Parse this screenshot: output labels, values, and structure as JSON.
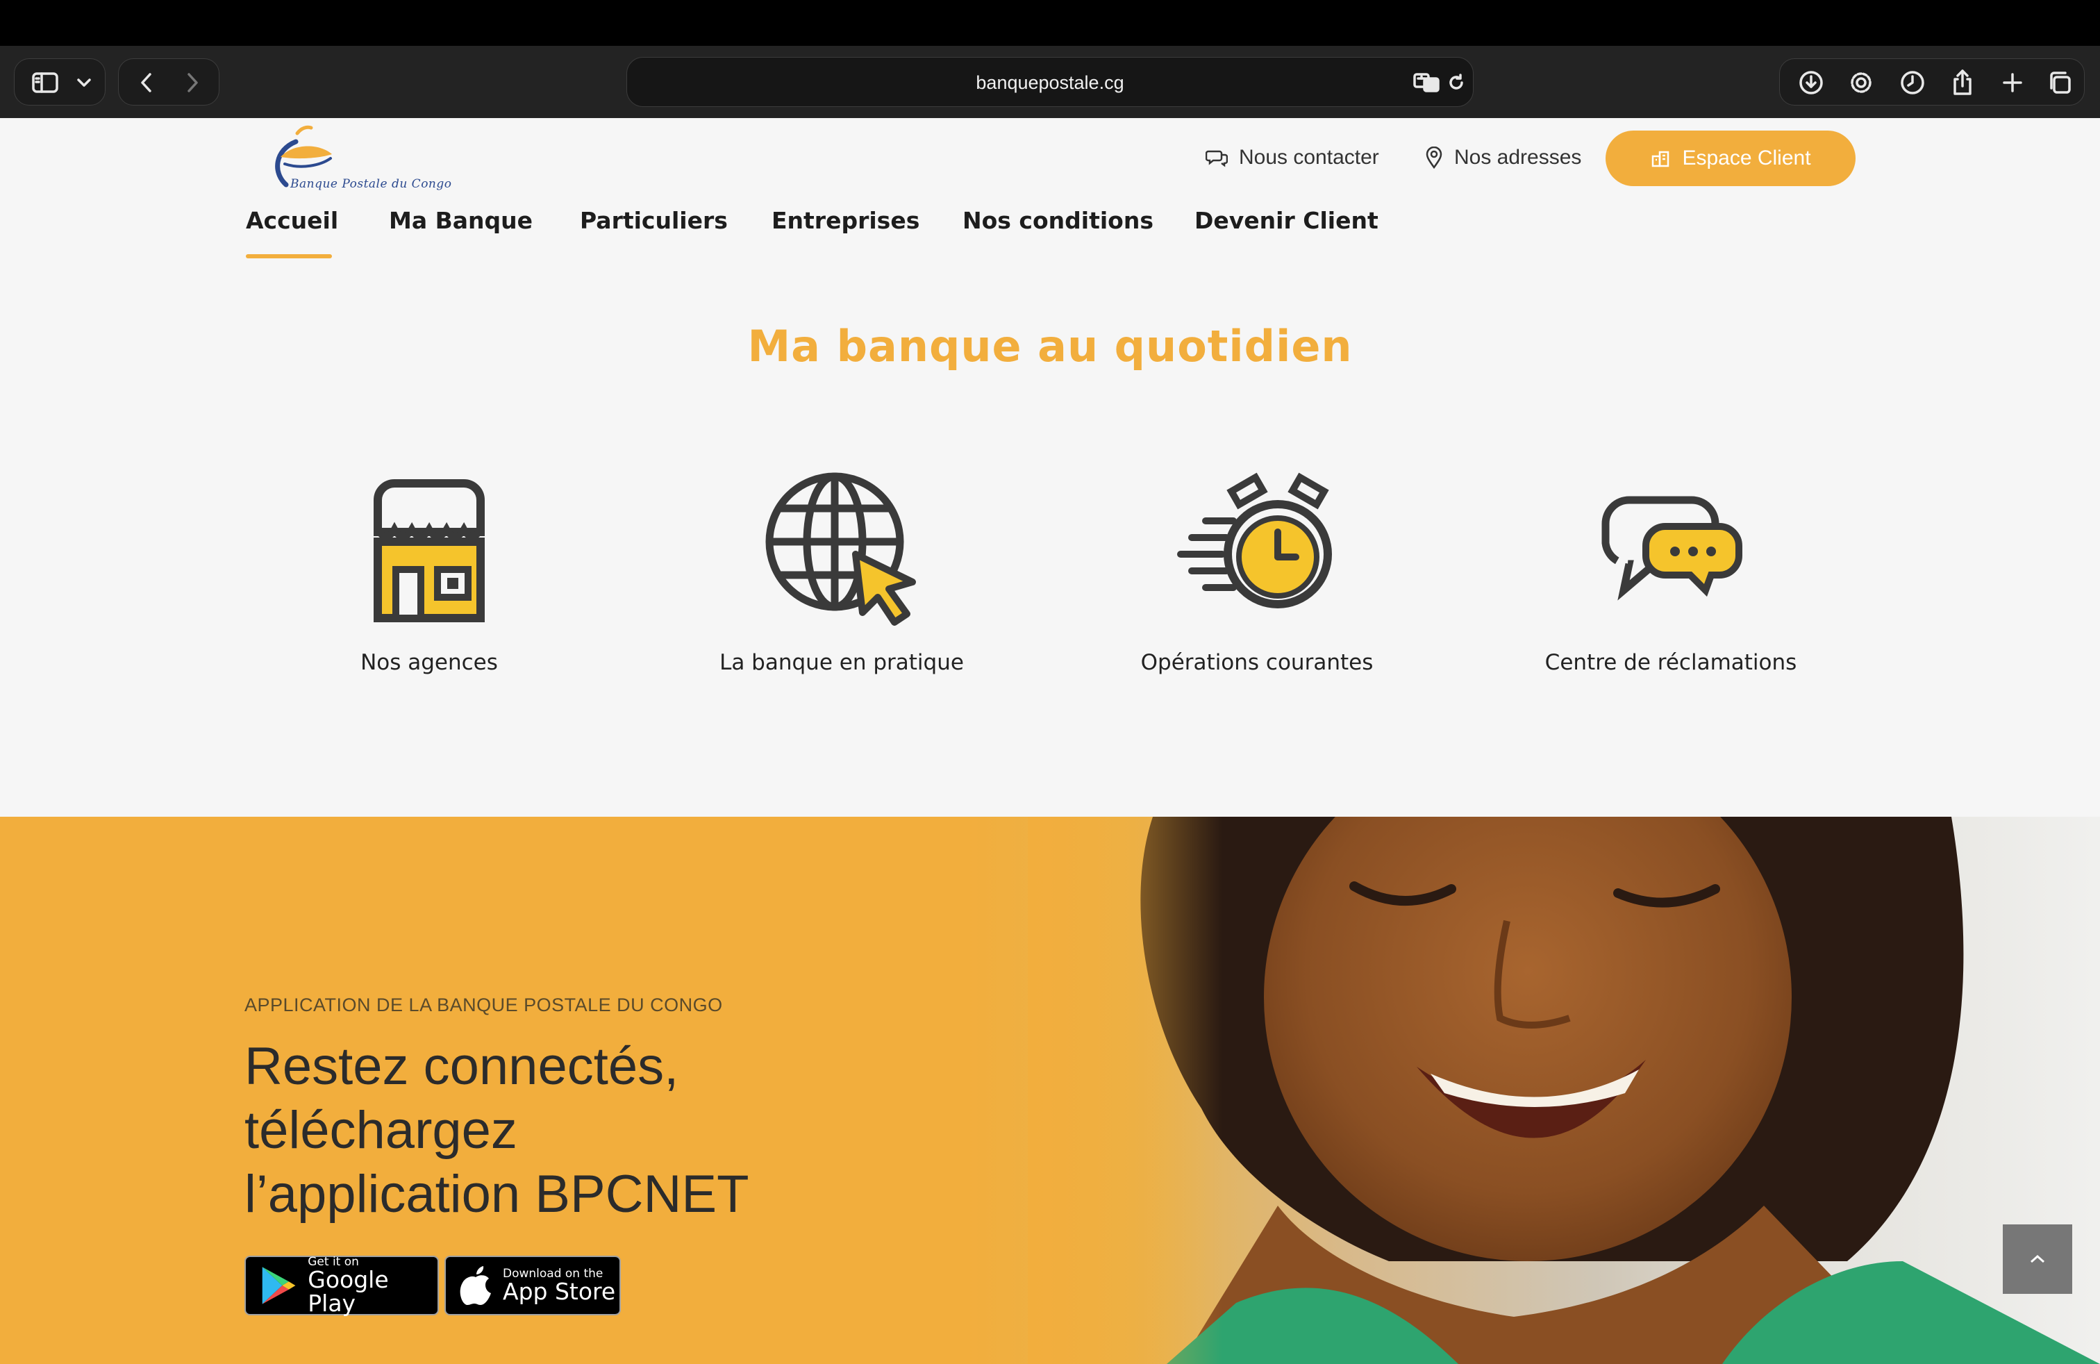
{
  "browser": {
    "url": "banquepostale.cg"
  },
  "header": {
    "logo_text": "Banque Postale du Congo",
    "contact_label": "Nous contacter",
    "addresses_label": "Nos adresses",
    "client_button": "Espace Client"
  },
  "nav": {
    "items": [
      {
        "label": "Accueil"
      },
      {
        "label": "Ma Banque"
      },
      {
        "label": "Particuliers"
      },
      {
        "label": "Entreprises"
      },
      {
        "label": "Nos conditions"
      },
      {
        "label": "Devenir Client"
      }
    ],
    "active": "Accueil"
  },
  "quotidien": {
    "title": "Ma banque au quotidien",
    "features": [
      {
        "label": "Nos agences",
        "icon": "storefront-icon"
      },
      {
        "label": "La banque en pratique",
        "icon": "globe-cursor-icon"
      },
      {
        "label": "Opérations courantes",
        "icon": "stopwatch-icon"
      },
      {
        "label": "Centre de réclamations",
        "icon": "chat-bubbles-icon"
      }
    ]
  },
  "app_banner": {
    "eyebrow": "APPLICATION DE LA BANQUE POSTALE DU CONGO",
    "headline_lines": [
      "Restez connectés,",
      "téléchargez",
      "l’application BPCNET"
    ],
    "google_play": {
      "small": "Get it on",
      "big": "Google Play"
    },
    "app_store": {
      "small": "Download on the",
      "big": "App Store"
    }
  },
  "colors": {
    "accent": "#f2ae3d",
    "icon_yellow": "#f5c42c",
    "icon_dark": "#3a3a3a",
    "text_dark": "#1d1d1d"
  }
}
